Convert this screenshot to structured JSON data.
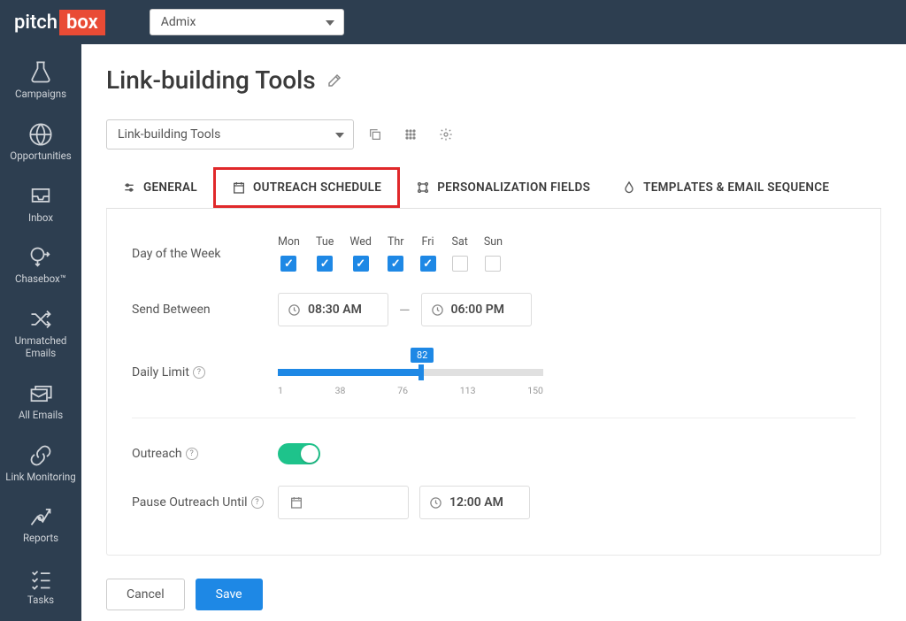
{
  "brand": {
    "pitch": "pitch",
    "box": "box"
  },
  "topbar": {
    "org": "Admix"
  },
  "sidebar": {
    "items": [
      {
        "label": "Campaigns"
      },
      {
        "label": "Opportunities"
      },
      {
        "label": "Inbox"
      },
      {
        "label": "Chasebox™"
      },
      {
        "label": "Unmatched Emails"
      },
      {
        "label": "All Emails"
      },
      {
        "label": "Link Monitoring"
      },
      {
        "label": "Reports"
      },
      {
        "label": "Tasks"
      }
    ]
  },
  "page": {
    "title": "Link-building Tools"
  },
  "campaign_select": {
    "label": "Link-building Tools"
  },
  "tabs": {
    "general": "GENERAL",
    "outreach_schedule": "OUTREACH SCHEDULE",
    "personalization": "PERSONALIZATION FIELDS",
    "templates": "TEMPLATES & EMAIL SEQUENCE"
  },
  "form": {
    "day_label": "Day of the Week",
    "days": [
      {
        "abbr": "Mon",
        "checked": true
      },
      {
        "abbr": "Tue",
        "checked": true
      },
      {
        "abbr": "Wed",
        "checked": true
      },
      {
        "abbr": "Thr",
        "checked": true
      },
      {
        "abbr": "Fri",
        "checked": true
      },
      {
        "abbr": "Sat",
        "checked": false
      },
      {
        "abbr": "Sun",
        "checked": false
      }
    ],
    "send_between_label": "Send Between",
    "start_time": "08:30 AM",
    "end_time": "06:00 PM",
    "daily_limit_label": "Daily Limit",
    "daily_limit_value": "82",
    "slider_ticks": [
      "1",
      "38",
      "76",
      "113",
      "150"
    ],
    "outreach_label": "Outreach",
    "pause_label": "Pause Outreach Until",
    "pause_time": "12:00 AM"
  },
  "buttons": {
    "cancel": "Cancel",
    "save": "Save"
  }
}
